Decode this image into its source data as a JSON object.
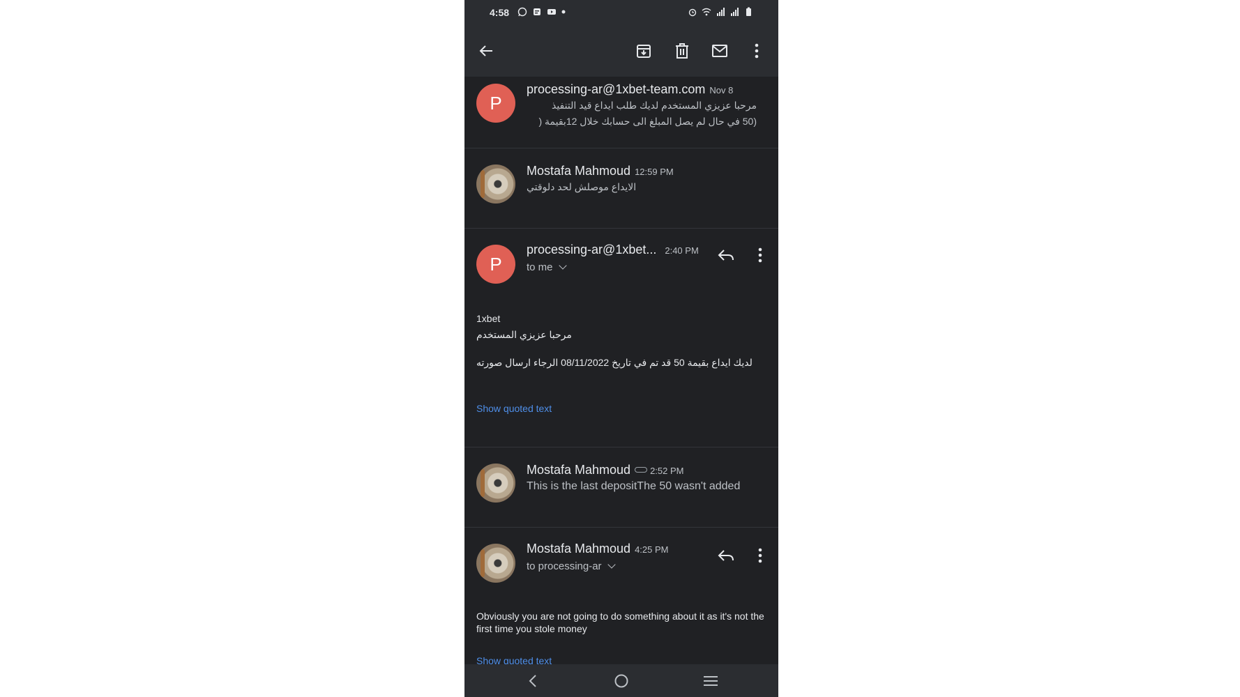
{
  "status_bar": {
    "time": "4:58",
    "left_icons": [
      "whatsapp-icon",
      "message-icon",
      "youtube-icon",
      "dot-icon"
    ],
    "right_icons": [
      "alarm-icon",
      "wifi-icon",
      "signal-icon",
      "signal-icon",
      "battery-icon"
    ]
  },
  "toolbar": {
    "icons": [
      "back-arrow-icon",
      "archive-icon",
      "delete-icon",
      "mark-unread-icon",
      "more-vert-icon"
    ]
  },
  "messages": [
    {
      "avatar_letter": "P",
      "sender": "processing-ar@1xbet-team.com",
      "time": "Nov 8",
      "snippet_line1": "مرحبا عزيزي المستخدم لديك طلب ايداع قيد التنفيذ",
      "snippet_line2": "(50 في حال لم يصل المبلغ الى حسابك خلال 12بقيمة ("
    },
    {
      "sender": "Mostafa Mahmoud",
      "time": "12:59 PM",
      "snippet": "الايداع موصلش لحد دلوقتي"
    },
    {
      "avatar_letter": "P",
      "sender": "processing-ar@1xbet...",
      "time": "2:40 PM",
      "recipient": "to me",
      "body_line1": "1xbet",
      "body_line2": "مرحبا عزيزي المستخدم",
      "body_line3": "لديك ايداع بقيمة 50 قد تم في تاريخ 08/11/2022 الرجاء ارسال صورته",
      "show_quoted": "Show quoted text"
    },
    {
      "sender": "Mostafa Mahmoud",
      "time": "2:52 PM",
      "snippet": "This is the last depositThe 50 wasn't added"
    },
    {
      "sender": "Mostafa Mahmoud",
      "time": "4:25 PM",
      "recipient": "to processing-ar",
      "body": "Obviously you are not going to do something about it as it's not the first time you stole money",
      "show_quoted": "Show quoted text"
    }
  ],
  "nav_bar": {
    "icons": [
      "nav-back-icon",
      "nav-home-icon",
      "nav-recents-icon"
    ]
  }
}
